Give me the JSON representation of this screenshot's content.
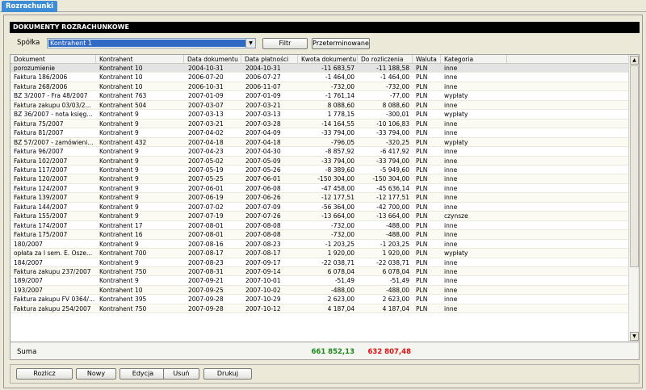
{
  "window": {
    "tab_label": "Rozrachunki"
  },
  "panel": {
    "title": "DOKUMENTY ROZRACHUNKOWE"
  },
  "filter": {
    "spolka_label": "Spółka",
    "spolka_value": "Kontrahent 1",
    "filtr_label": "Filtr",
    "przeterminowane_label": "Przeterminowane"
  },
  "columns": [
    "Dokument",
    "Kontrahent",
    "Data dokumentu",
    "Data płatności",
    "Kwota dokumentu",
    "Do rozliczenia",
    "Waluta",
    "Kategoria"
  ],
  "rows": [
    [
      "porozumienie",
      "Kontrahent 10",
      "2004-10-31",
      "2004-10-31",
      "-11 683,57",
      "-11 188,58",
      "PLN",
      "inne"
    ],
    [
      "Faktura 186/2006",
      "Kontrahent 10",
      "2006-07-20",
      "2006-07-27",
      "-1 464,00",
      "-1 464,00",
      "PLN",
      "inne"
    ],
    [
      "Faktura 268/2006",
      "Kontrahent 10",
      "2006-10-31",
      "2006-11-07",
      "-732,00",
      "-732,00",
      "PLN",
      "inne"
    ],
    [
      "BZ 3/2007 - Fra 48/2007",
      "Kontrahent 763",
      "2007-01-09",
      "2007-01-09",
      "-1 761,14",
      "-77,00",
      "PLN",
      "wypłaty"
    ],
    [
      "Faktura zakupu 03/03/2...",
      "Kontrahent 504",
      "2007-03-07",
      "2007-03-21",
      "8 088,60",
      "8 088,60",
      "PLN",
      "inne"
    ],
    [
      "BZ 36/2007 - nota księg...",
      "Kontrahent 9",
      "2007-03-13",
      "2007-03-13",
      "1 778,15",
      "-300,01",
      "PLN",
      "wypłaty"
    ],
    [
      "Faktura 75/2007",
      "Kontrahent 9",
      "2007-03-21",
      "2007-03-28",
      "-14 164,55",
      "-10 106,83",
      "PLN",
      "inne"
    ],
    [
      "Faktura 81/2007",
      "Kontrahent 9",
      "2007-04-02",
      "2007-04-09",
      "-33 794,00",
      "-33 794,00",
      "PLN",
      "inne"
    ],
    [
      "BZ 57/2007 - zamówieni...",
      "Kontrahent 432",
      "2007-04-18",
      "2007-04-18",
      "-796,05",
      "-320,25",
      "PLN",
      "wypłaty"
    ],
    [
      "Faktura 96/2007",
      "Kontrahent 9",
      "2007-04-23",
      "2007-04-30",
      "-8 857,92",
      "-6 417,92",
      "PLN",
      "inne"
    ],
    [
      "Faktura 102/2007",
      "Kontrahent 9",
      "2007-05-02",
      "2007-05-09",
      "-33 794,00",
      "-33 794,00",
      "PLN",
      "inne"
    ],
    [
      "Faktura 117/2007",
      "Kontrahent 9",
      "2007-05-19",
      "2007-05-26",
      "-8 389,60",
      "-5 949,60",
      "PLN",
      "inne"
    ],
    [
      "Faktura 120/2007",
      "Kontrahent 9",
      "2007-05-25",
      "2007-06-01",
      "-150 304,00",
      "-150 304,00",
      "PLN",
      "inne"
    ],
    [
      "Faktura 124/2007",
      "Kontrahent 9",
      "2007-06-01",
      "2007-06-08",
      "-47 458,00",
      "-45 636,14",
      "PLN",
      "inne"
    ],
    [
      "Faktura 139/2007",
      "Kontrahent 9",
      "2007-06-19",
      "2007-06-26",
      "-12 177,51",
      "-12 177,51",
      "PLN",
      "inne"
    ],
    [
      "Faktura 144/2007",
      "Kontrahent 9",
      "2007-07-02",
      "2007-07-09",
      "-56 364,00",
      "-42 700,00",
      "PLN",
      "inne"
    ],
    [
      "Faktura 155/2007",
      "Kontrahent 9",
      "2007-07-19",
      "2007-07-26",
      "-13 664,00",
      "-13 664,00",
      "PLN",
      "czynsze"
    ],
    [
      "Faktura 174/2007",
      "Kontrahent 17",
      "2007-08-01",
      "2007-08-08",
      "-732,00",
      "-488,00",
      "PLN",
      "inne"
    ],
    [
      "Faktura 175/2007",
      "Kontrahent 16",
      "2007-08-01",
      "2007-08-08",
      "-732,00",
      "-488,00",
      "PLN",
      "inne"
    ],
    [
      "180/2007",
      "Kontrahent 9",
      "2007-08-16",
      "2007-08-23",
      "-1 203,25",
      "-1 203,25",
      "PLN",
      "inne"
    ],
    [
      "opłata za I sem. E. Osze...",
      "Kontrahent 700",
      "2007-08-17",
      "2007-08-17",
      "1 920,00",
      "1 920,00",
      "PLN",
      "wypłaty"
    ],
    [
      "184/2007",
      "Kontrahent 9",
      "2007-08-23",
      "2007-09-17",
      "-22 038,71",
      "-22 038,71",
      "PLN",
      "inne"
    ],
    [
      "Faktura zakupu 237/2007",
      "Kontrahent 750",
      "2007-08-31",
      "2007-09-14",
      "6 078,04",
      "6 078,04",
      "PLN",
      "inne"
    ],
    [
      "189/2007",
      "Kontrahent 9",
      "2007-09-21",
      "2007-10-01",
      "-51,49",
      "-51,49",
      "PLN",
      "inne"
    ],
    [
      "193/2007",
      "Kontrahent 10",
      "2007-09-25",
      "2007-10-02",
      "-488,00",
      "-488,00",
      "PLN",
      "inne"
    ],
    [
      "Faktura zakupu FV 0364/...",
      "Kontrahent 395",
      "2007-09-28",
      "2007-10-29",
      "2 623,00",
      "2 623,00",
      "PLN",
      "inne"
    ],
    [
      "Faktura zakupu 254/2007",
      "Kontrahent 750",
      "2007-09-28",
      "2007-10-12",
      "4 187,04",
      "4 187,04",
      "PLN",
      "inne"
    ]
  ],
  "summary": {
    "label": "Suma",
    "kwota": "661 852,13",
    "do_rozliczenia": "632 807,48",
    "kwota_color": "#1a8a1a",
    "do_rozliczenia_color": "#e01010"
  },
  "bottom_buttons": [
    "Rozlicz",
    "Nowy",
    "Edycja",
    "Usuń",
    "Drukuj"
  ],
  "icons": {
    "dropdown": "chevron-down-icon",
    "scroll_up": "scroll-up-arrow-icon",
    "scroll_down": "scroll-down-arrow-icon"
  }
}
